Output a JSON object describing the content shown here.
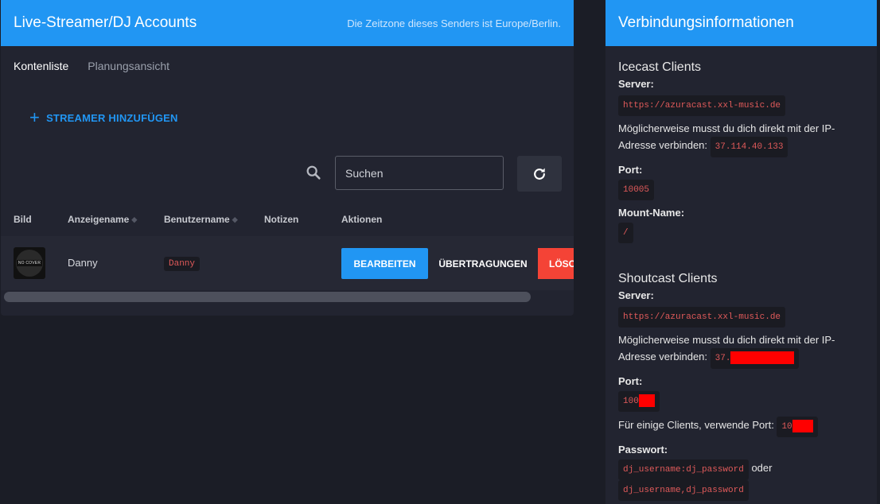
{
  "streamers_card": {
    "title": "Live-Streamer/DJ Accounts",
    "timezone_note": "Die Zeitzone dieses Senders ist Europe/Berlin.",
    "tabs": [
      {
        "label": "Kontenliste",
        "active": true
      },
      {
        "label": "Planungsansicht",
        "active": false
      }
    ],
    "add_button_label": "STREAMER HINZUFÜGEN",
    "search": {
      "placeholder": "Suchen",
      "value": ""
    },
    "table": {
      "columns": [
        "Bild",
        "Anzeigename",
        "Benutzername",
        "Notizen",
        "Aktionen"
      ],
      "rows": [
        {
          "avatar_text": "NO COVER",
          "display_name": "Danny",
          "username": "Danny",
          "notes": "",
          "actions": [
            "BEARBEITEN",
            "ÜBERTRAGUNGEN",
            "LÖSC"
          ]
        }
      ]
    }
  },
  "connection_card": {
    "title": "Verbindungsinformationen",
    "icecast": {
      "heading": "Icecast Clients",
      "server_label": "Server:",
      "server": "https://azuracast.xxl-music.de",
      "ip_note_line1": "Möglicherweise musst du dich direkt mit der IP-",
      "ip_note_line2": "Adresse verbinden:",
      "ip": "37.114.40.133",
      "port_label": "Port:",
      "port": "10005",
      "mount_label": "Mount-Name:",
      "mount": "/"
    },
    "shoutcast": {
      "heading": "Shoutcast Clients",
      "server_label": "Server:",
      "server": "https://azuracast.xxl-music.de",
      "ip_note_line1": "Möglicherweise musst du dich direkt mit der IP-",
      "ip_note_line2": "Adresse verbinden:",
      "ip_visible": "37.",
      "port_label": "Port:",
      "port_visible": "100",
      "some_clients_note": "Für einige Clients, verwende Port:",
      "some_clients_port_visible": "10",
      "password_label": "Passwort:",
      "password_format_1": "dj_username:dj_password",
      "password_or": "oder",
      "password_format_2": "dj_username,dj_password"
    }
  },
  "colors": {
    "accent": "#2196f3",
    "danger": "#f44336",
    "background": "#1b1d26",
    "card": "#222430",
    "code_text": "#e05a5a",
    "redaction": "#ff0000"
  }
}
